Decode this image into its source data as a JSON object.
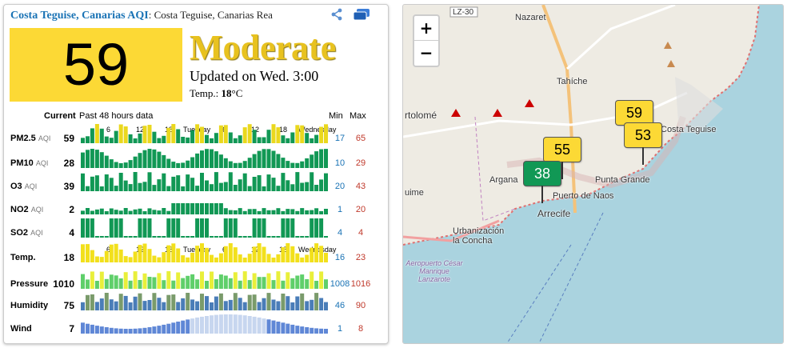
{
  "header": {
    "city": "Costa Teguise, Canarias AQI",
    "subtitle": ": Costa Teguise, Canarias Rea"
  },
  "aqi": {
    "value": "59",
    "level": "Moderate",
    "updated": "Updated on Wed. 3:00",
    "temp_label": "Temp.: ",
    "temp_value": "18",
    "temp_unit": "°C"
  },
  "table": {
    "current_label": "Current",
    "history_label": "Past 48 hours data",
    "min_label": "Min",
    "max_label": "Max",
    "ticks_top": [
      "6",
      "12",
      "18",
      "Tuesday",
      "6",
      "12",
      "18",
      "Wednesday"
    ],
    "ticks_mid": [
      "6",
      "12",
      "18",
      "Tuesday",
      "6",
      "12",
      "18",
      "Wednesday"
    ],
    "rows": [
      {
        "name": "PM2.5",
        "unit": "AQI",
        "current": "59",
        "min": "17",
        "max": "65",
        "color": "#119855",
        "alt": "#ead81e"
      },
      {
        "name": "PM10",
        "unit": "AQI",
        "current": "28",
        "min": "10",
        "max": "29",
        "color": "#119855",
        "alt": "#119855"
      },
      {
        "name": "O3",
        "unit": "AQI",
        "current": "39",
        "min": "20",
        "max": "43",
        "color": "#119855",
        "alt": "#119855"
      },
      {
        "name": "NO2",
        "unit": "AQI",
        "current": "2",
        "min": "1",
        "max": "20",
        "color": "#119855",
        "alt": "#119855"
      },
      {
        "name": "SO2",
        "unit": "AQI",
        "current": "4",
        "min": "4",
        "max": "4",
        "color": "#119855",
        "alt": "#119855"
      },
      {
        "name": "Temp.",
        "unit": "",
        "current": "18",
        "min": "16",
        "max": "23",
        "color": "#f2e01c",
        "alt": "#f2e01c"
      },
      {
        "name": "Pressure",
        "unit": "",
        "current": "1010",
        "min": "1008",
        "max": "1016",
        "color": "#5fcf6a",
        "alt": "#e9ef3a"
      },
      {
        "name": "Humidity",
        "unit": "",
        "current": "75",
        "min": "46",
        "max": "90",
        "color": "#4a7db8",
        "alt": "#7a9b6b"
      },
      {
        "name": "Wind",
        "unit": "",
        "current": "7",
        "min": "1",
        "max": "8",
        "color": "#5f87d6",
        "alt": "#c7d6ef"
      }
    ]
  },
  "map": {
    "zoom_in": "+",
    "zoom_out": "−",
    "road_label": "LZ-30",
    "places": [
      "Nazaret",
      "Tahíche",
      "rtolomé",
      "Costa Teguise",
      "Punta Grande",
      "Argana",
      "Puerto de Naos",
      "Arrecife",
      "uime",
      "Urbanización la Concha",
      "Aeropuerto César Manrique Lanzarote"
    ],
    "markers": [
      {
        "value": "59",
        "color": "#fcd935"
      },
      {
        "value": "53",
        "color": "#fcd935"
      },
      {
        "value": "55",
        "color": "#fcd935"
      },
      {
        "value": "38",
        "color": "#119855"
      }
    ]
  }
}
